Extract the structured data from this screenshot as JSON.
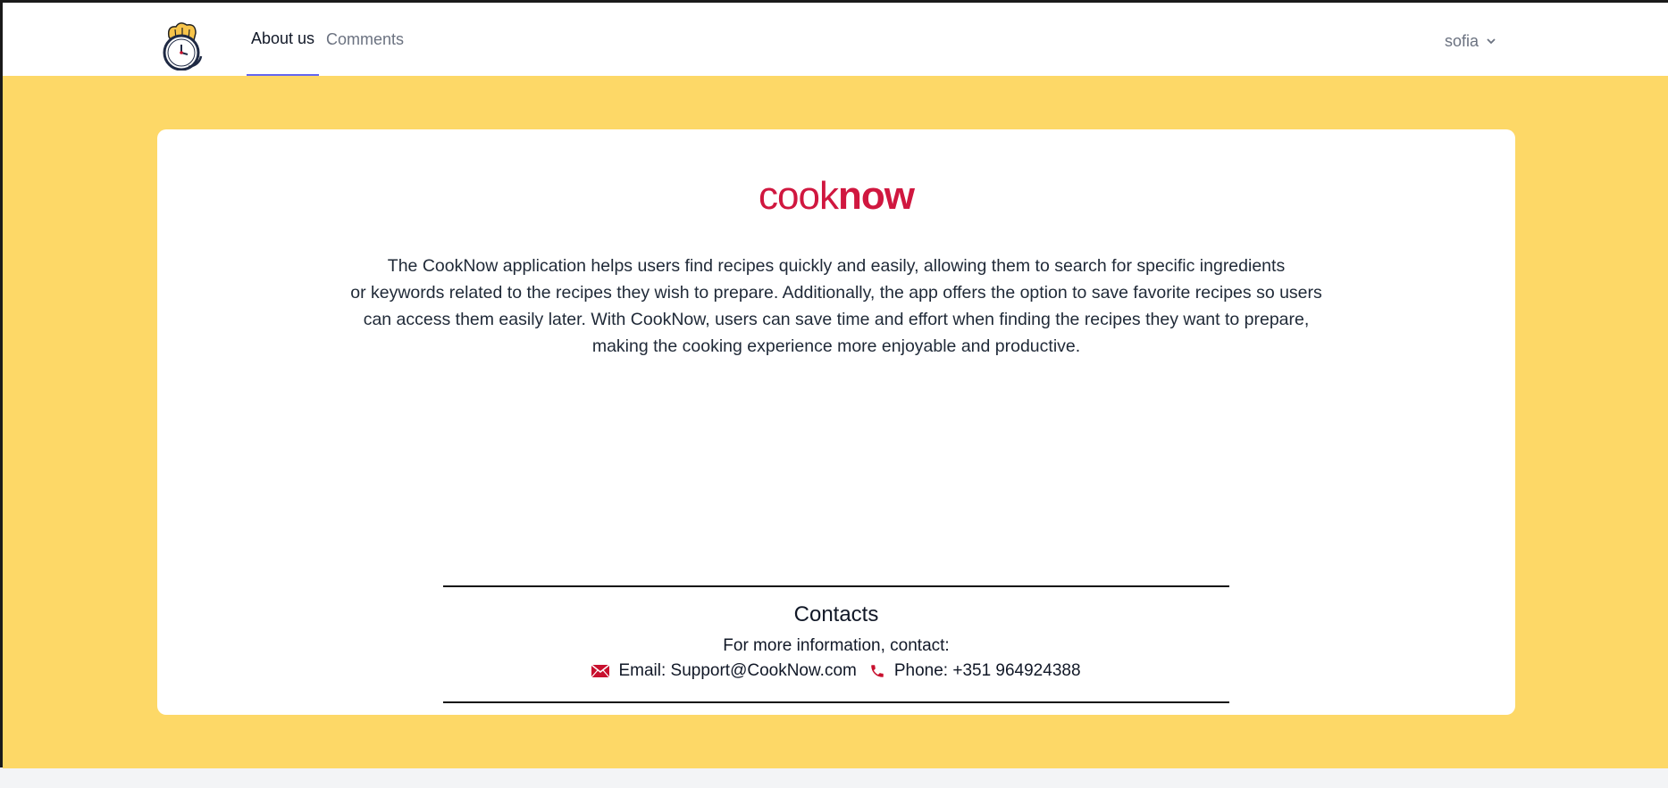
{
  "nav": {
    "tabs": [
      {
        "label": "About us",
        "active": true
      },
      {
        "label": "Comments",
        "active": false
      }
    ],
    "user": "sofia",
    "logo_icon": "chef-clock-logo"
  },
  "about": {
    "brand_light": "cook",
    "brand_bold": "now",
    "description_lines": [
      "The CookNow application helps users find recipes quickly and easily, allowing them to search for specific ingredients",
      "or keywords related to the recipes they wish to prepare. Additionally, the app offers the option to save favorite recipes so users",
      "can access them easily later. With CookNow, users can save time and effort when finding the recipes they want to prepare,",
      "making the cooking experience more enjoyable and productive."
    ]
  },
  "contacts": {
    "title": "Contacts",
    "subtitle": "For more information, contact:",
    "email": "Email: Support@CookNow.com",
    "phone": "Phone: +351 964924388"
  },
  "colors": {
    "brand": "#d0173f",
    "background": "#fdd867",
    "active_tab_underline": "#6366f1",
    "icon_red": "#c8102e"
  }
}
